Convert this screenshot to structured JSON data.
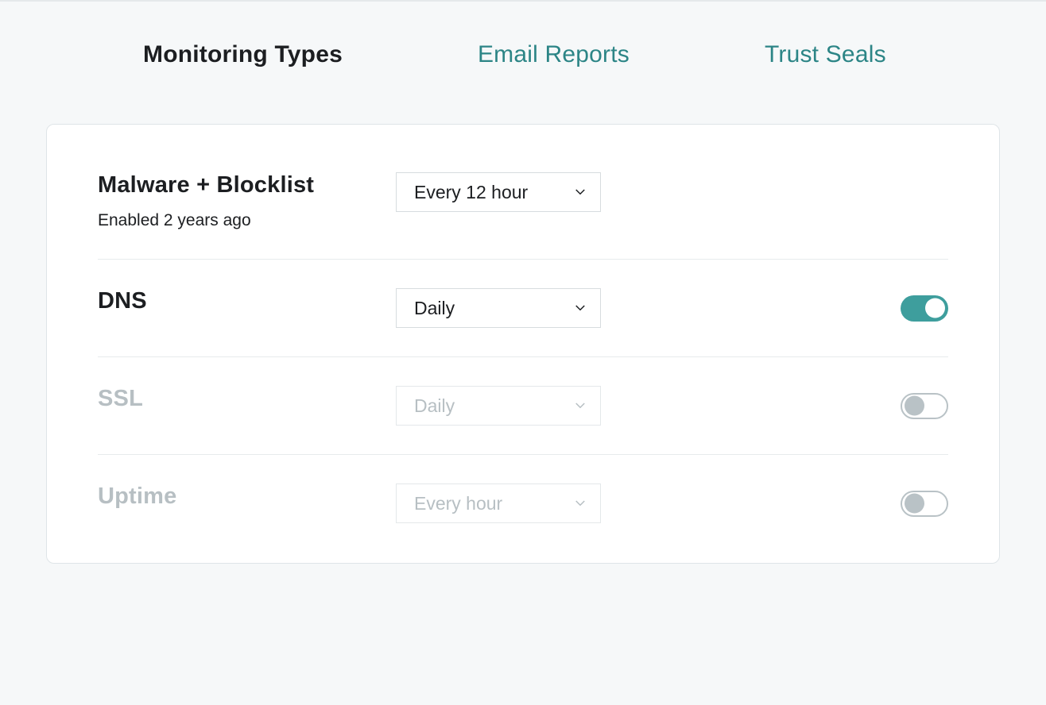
{
  "tabs": {
    "monitoring_types": "Monitoring Types",
    "email_reports": "Email Reports",
    "trust_seals": "Trust Seals",
    "active": "monitoring_types"
  },
  "rows": {
    "malware": {
      "title": "Malware + Blocklist",
      "subtitle": "Enabled 2 years ago",
      "frequency": "Every 12 hour",
      "toggle": null,
      "disabled": false
    },
    "dns": {
      "title": "DNS",
      "frequency": "Daily",
      "toggle": true,
      "disabled": false
    },
    "ssl": {
      "title": "SSL",
      "frequency": "Daily",
      "toggle": false,
      "disabled": true
    },
    "uptime": {
      "title": "Uptime",
      "frequency": "Every hour",
      "toggle": false,
      "disabled": true
    }
  },
  "colors": {
    "accent": "#3e9e9d",
    "tab_link": "#2c8586",
    "text": "#1c1e21",
    "muted": "#b7bfc3",
    "border": "#dfe5e8",
    "bg": "#f6f8f9"
  }
}
